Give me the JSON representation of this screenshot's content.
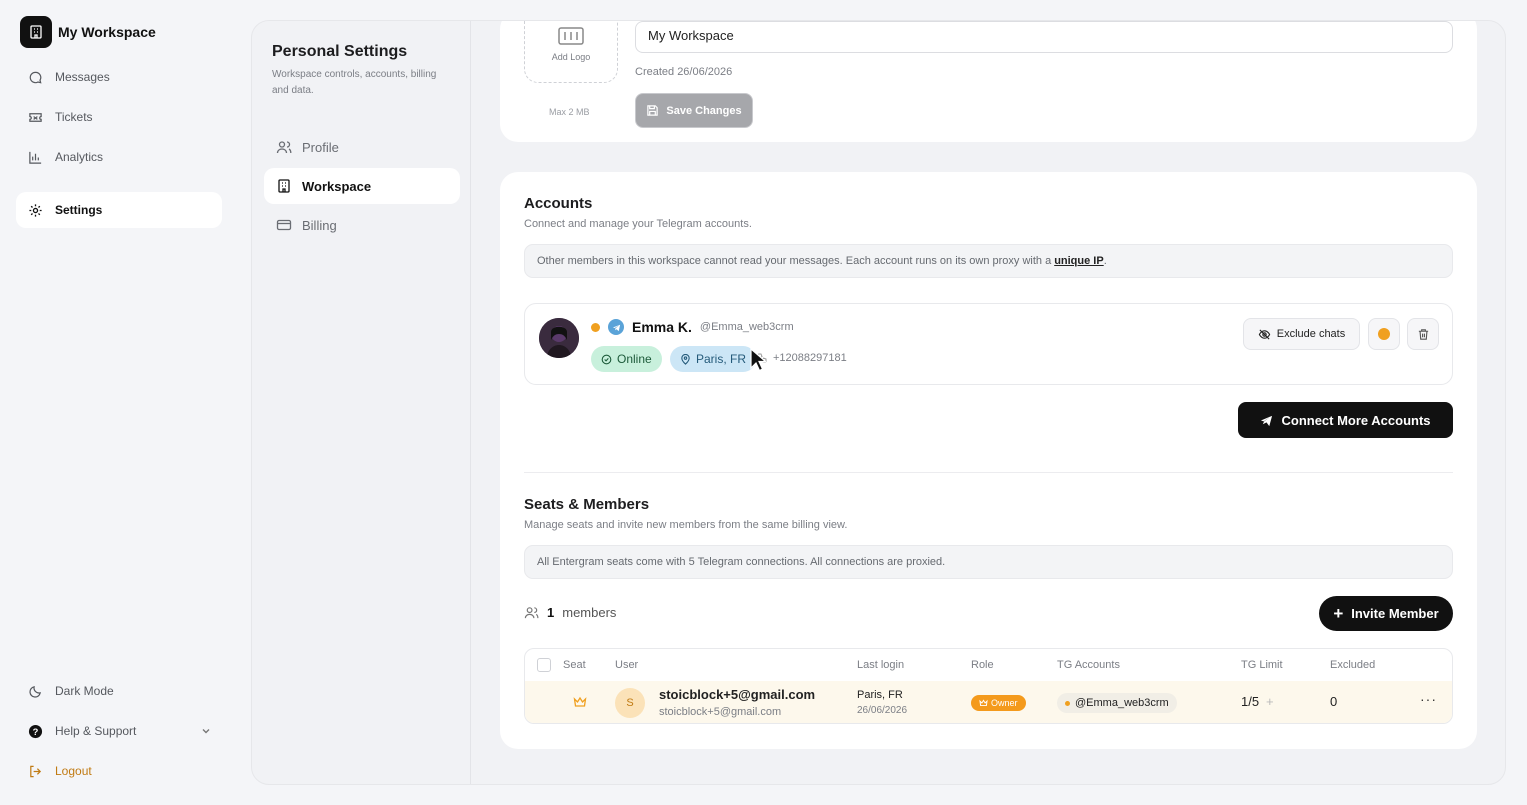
{
  "sidebar": {
    "workspace_name": "My Workspace",
    "items": [
      {
        "label": "Messages",
        "icon": "message-icon"
      },
      {
        "label": "Tickets",
        "icon": "ticket-icon"
      },
      {
        "label": "Analytics",
        "icon": "chart-icon"
      },
      {
        "label": "Settings",
        "icon": "gear-icon",
        "active": true
      }
    ],
    "bottom": {
      "dark_mode": "Dark Mode",
      "help": "Help & Support",
      "logout": "Logout"
    }
  },
  "settings_nav": {
    "title": "Personal Settings",
    "description": "Workspace controls, accounts, billing and data.",
    "items": [
      {
        "label": "Profile",
        "icon": "users-icon"
      },
      {
        "label": "Workspace",
        "icon": "building-icon",
        "active": true
      },
      {
        "label": "Billing",
        "icon": "card-icon"
      }
    ]
  },
  "workspace_card": {
    "add_logo": "Add Logo",
    "max_size": "Max 2 MB",
    "name_value": "My Workspace",
    "created": "Created 26/06/2026",
    "save_label": "Save Changes"
  },
  "accounts": {
    "title": "Accounts",
    "description": "Connect and manage your Telegram accounts.",
    "info": "Other members in this workspace cannot read your messages. Each account runs on its own proxy with a",
    "info_link": "unique IP",
    "info_end": ".",
    "account": {
      "name": "Emma K.",
      "handle": "@Emma_web3crm",
      "status": "Online",
      "location": "Paris, FR",
      "phone": "+12088297181"
    },
    "exclude_label": "Exclude chats",
    "connect_label": "Connect More Accounts"
  },
  "seats": {
    "title": "Seats & Members",
    "description": "Manage seats and invite new members from the same billing view.",
    "info": "All Entergram seats come with 5 Telegram connections. All connections are proxied.",
    "count": "1",
    "count_suffix": "members",
    "invite_label": "Invite Member",
    "columns": [
      "Seat",
      "User",
      "Last login",
      "Role",
      "TG Accounts",
      "TG Limit",
      "Excluded"
    ],
    "rows": [
      {
        "initial": "S",
        "email": "stoicblock+5@gmail.com",
        "email_sub": "stoicblock+5@gmail.com",
        "last_login_place": "Paris, FR",
        "last_login_date": "26/06/2026",
        "role": "Owner",
        "tg_account": "@Emma_web3crm",
        "tg_limit": "1/5",
        "excluded": "0"
      }
    ]
  },
  "colors": {
    "accent": "#111111",
    "owner": "#f49a1c",
    "online_bg": "#c8f0dc",
    "location_bg": "#cce6f6",
    "logout": "#c07a12"
  }
}
